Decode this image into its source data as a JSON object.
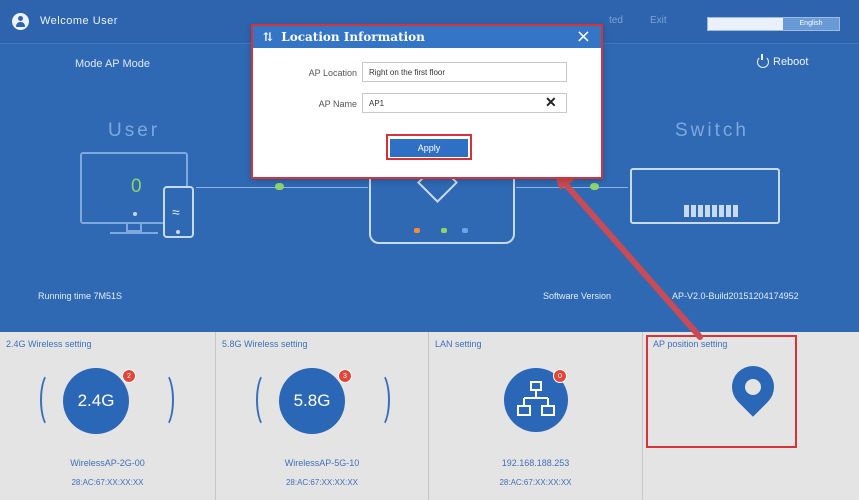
{
  "header": {
    "welcome": "Welcome User",
    "faded_tabs": [
      "ted",
      "Exit"
    ],
    "language": "English"
  },
  "status": {
    "mode_label": "Mode AP Mode",
    "reboot_label": "Reboot",
    "user_label": "User",
    "switch_label": "Switch",
    "client_count": "0",
    "running_time_label": "Running time  7M51S",
    "software_version_label": "Software Version",
    "software_version_value": "AP-V2.0-Build20151204174952"
  },
  "panels": [
    {
      "title": "2.4G Wireless setting",
      "circle_text": "2.4G",
      "badge": "2",
      "line1": "WirelessAP-2G-00",
      "line2": "28:AC:67:XX:XX:XX"
    },
    {
      "title": "5.8G Wireless setting",
      "circle_text": "5.8G",
      "badge": "3",
      "line1": "WirelessAP-5G-10",
      "line2": "28:AC:67:XX:XX:XX"
    },
    {
      "title": "LAN setting",
      "badge": "0",
      "line1": "192.168.188.253",
      "line2": "28:AC:67:XX:XX:XX"
    },
    {
      "title": "AP position setting"
    }
  ],
  "dialog": {
    "title": "Location Information",
    "location_label": "AP Location",
    "location_value": "Right on the first floor",
    "name_label": "AP Name",
    "name_value": "AP1",
    "apply_label": "Apply"
  },
  "colors": {
    "header_bg": "#2d64ad",
    "panel_bg": "#e4e4e4",
    "accent_blue": "#2b67b7",
    "highlight_red": "#d6323a",
    "status_green": "#8fd36a"
  }
}
